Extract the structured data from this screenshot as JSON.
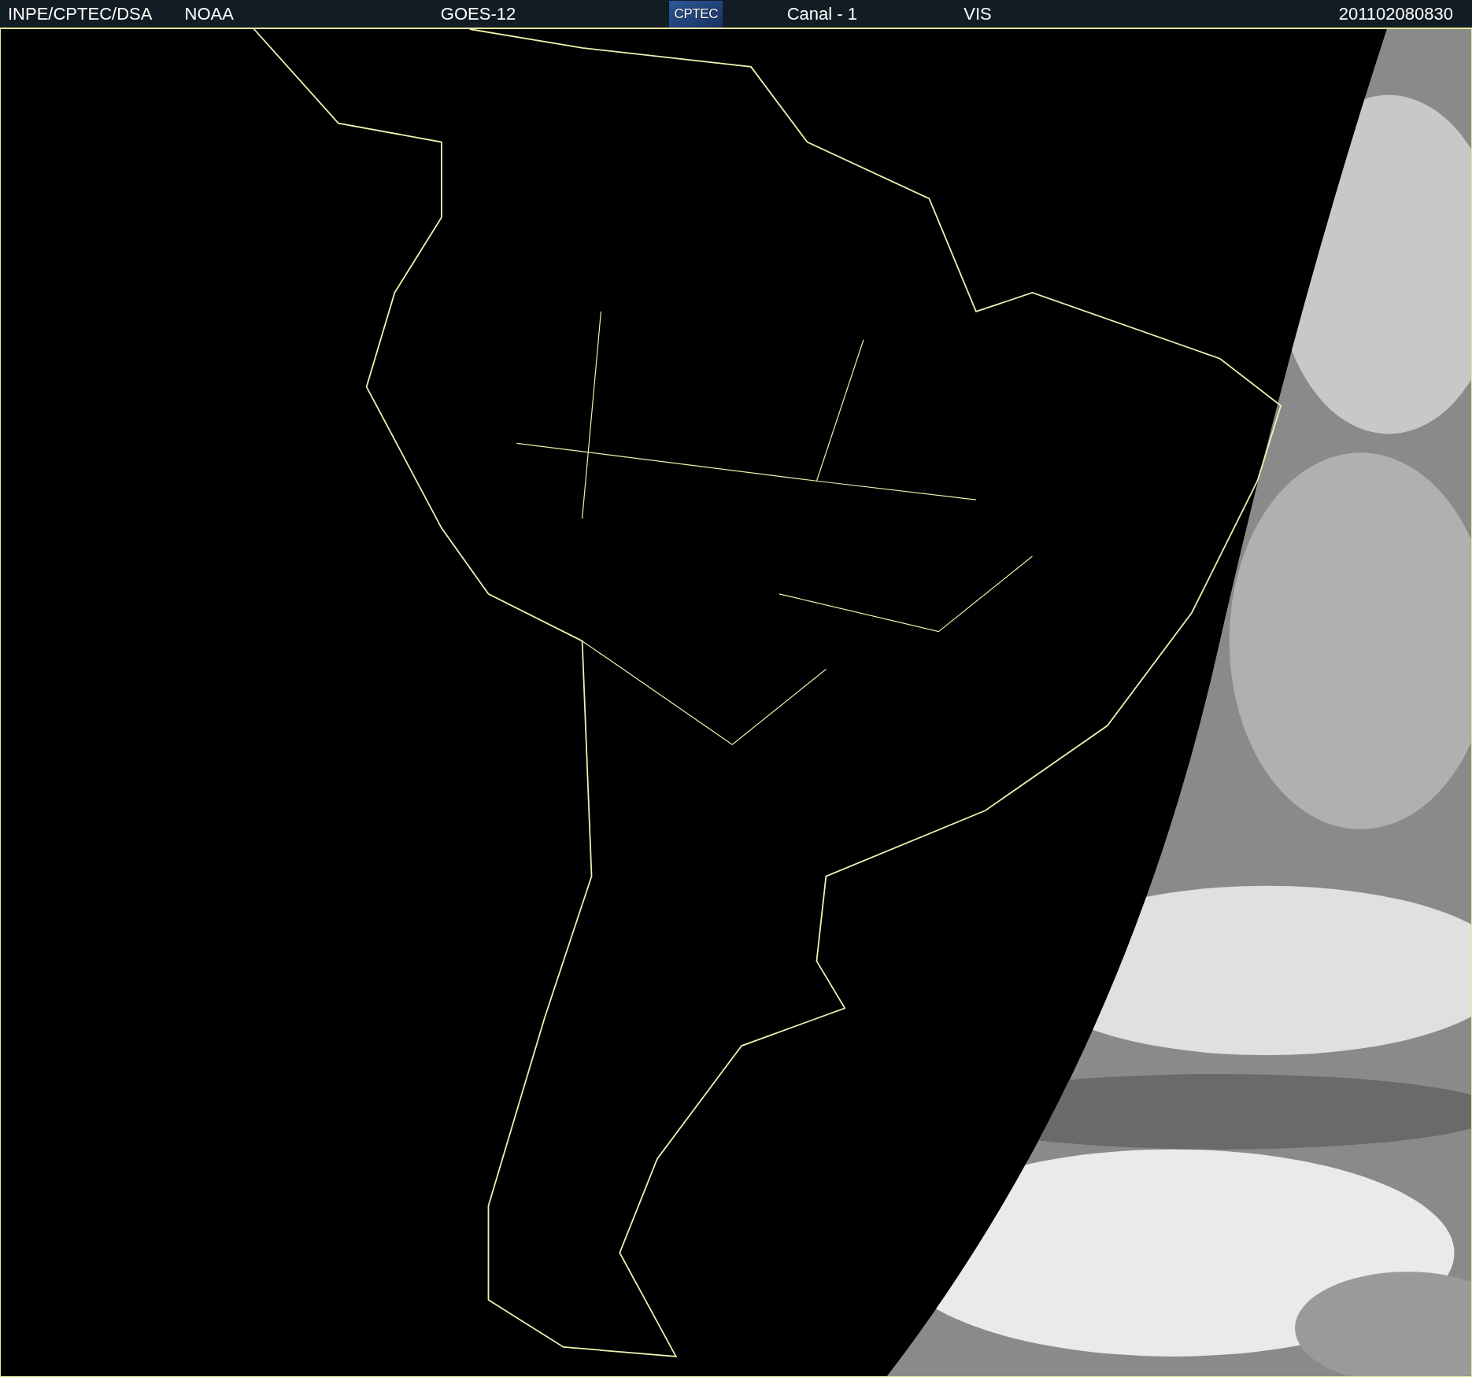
{
  "header": {
    "items": [
      {
        "kind": "text",
        "text": "INPE/CPTEC/DSA"
      },
      {
        "kind": "text",
        "text": "NOAA"
      },
      {
        "kind": "text",
        "text": "GOES-12"
      },
      {
        "kind": "logo",
        "text": "CPTEC"
      },
      {
        "kind": "text",
        "text": "Canal - 1"
      },
      {
        "kind": "text",
        "text": "VIS"
      },
      {
        "kind": "text",
        "text": "201102080830"
      }
    ]
  }
}
